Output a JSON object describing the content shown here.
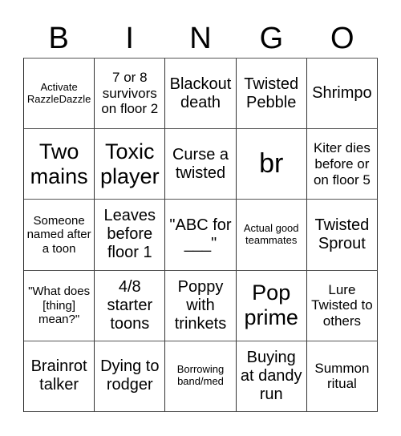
{
  "header": {
    "letters": [
      "B",
      "I",
      "N",
      "G",
      "O"
    ]
  },
  "cells": [
    [
      "Activate RazzleDazzle",
      "7 or 8 survivors on floor 2",
      "Blackout death",
      "Twisted Pebble",
      "Shrimpo"
    ],
    [
      "Two mains",
      "Toxic player",
      "Curse a twisted",
      "br",
      "Kiter dies before or on floor 5"
    ],
    [
      "Someone named after a toon",
      "Leaves before floor 1",
      "\"ABC for ___\"",
      "Actual good teammates",
      "Twisted Sprout"
    ],
    [
      "\"What does [thing] mean?\"",
      "4/8 starter toons",
      "Poppy with trinkets",
      "Pop prime",
      "Lure Twisted to others"
    ],
    [
      "Brainrot talker",
      "Dying to rodger",
      "Borrowing band/med",
      "Buying at dandy run",
      "Summon ritual"
    ]
  ]
}
